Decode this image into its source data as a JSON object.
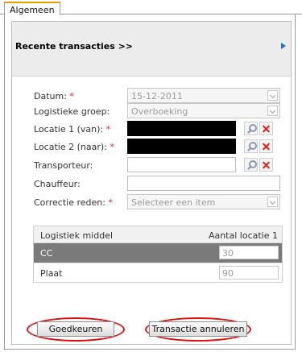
{
  "tab": {
    "label": "Algemeen"
  },
  "header": {
    "title": "Recente transacties >>"
  },
  "form": {
    "datum": {
      "label": "Datum:",
      "required": "*",
      "value": "15-12-2011"
    },
    "groep": {
      "label": "Logistieke groep:",
      "value": "Overboeking"
    },
    "locatie1": {
      "label": "Locatie 1 (van):",
      "required": "*"
    },
    "locatie2": {
      "label": "Locatie 2 (naar):",
      "required": "*"
    },
    "transporteur": {
      "label": "Transporteur:"
    },
    "chauffeur": {
      "label": "Chauffeur:"
    },
    "correctie": {
      "label": "Correctie reden:",
      "required": "*",
      "value": "Selecteer een item"
    }
  },
  "table": {
    "col1": "Logistiek middel",
    "col2": "Aantal locatie 1",
    "rows": [
      {
        "name": "CC",
        "qty": "30"
      },
      {
        "name": "Plaat",
        "qty": "90"
      }
    ]
  },
  "buttons": {
    "approve": "Goedkeuren",
    "cancel": "Transactie annuleren"
  },
  "colors": {
    "accent_tab": "#e0a000",
    "required": "#e02020",
    "highlight_ring": "#e01010",
    "arrow": "#1e6ee0"
  }
}
